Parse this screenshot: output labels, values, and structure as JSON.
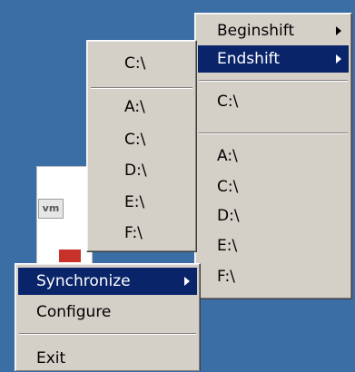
{
  "menus": {
    "context": {
      "items": [
        {
          "label": "Synchronize",
          "submenu": true,
          "selected": true
        },
        {
          "label": "Configure"
        },
        {
          "label": "Exit"
        }
      ]
    },
    "drives": {
      "items": [
        {
          "label": "C:\\"
        },
        {
          "label": "A:\\"
        },
        {
          "label": "C:\\"
        },
        {
          "label": "D:\\"
        },
        {
          "label": "E:\\"
        },
        {
          "label": "F:\\"
        }
      ]
    },
    "sync": {
      "items": [
        {
          "label": "Beginshift",
          "submenu": true
        },
        {
          "label": "Endshift",
          "submenu": true,
          "selected": true
        },
        {
          "label": "C:\\"
        },
        {
          "label": "A:\\"
        },
        {
          "label": "C:\\"
        },
        {
          "label": "D:\\"
        },
        {
          "label": "E:\\"
        },
        {
          "label": "F:\\"
        }
      ]
    }
  },
  "app_icon": {
    "label": "vm"
  },
  "colors": {
    "desktop": "#3a6ea5",
    "menu": "#d4d0c8",
    "highlight": "#0a246a"
  }
}
